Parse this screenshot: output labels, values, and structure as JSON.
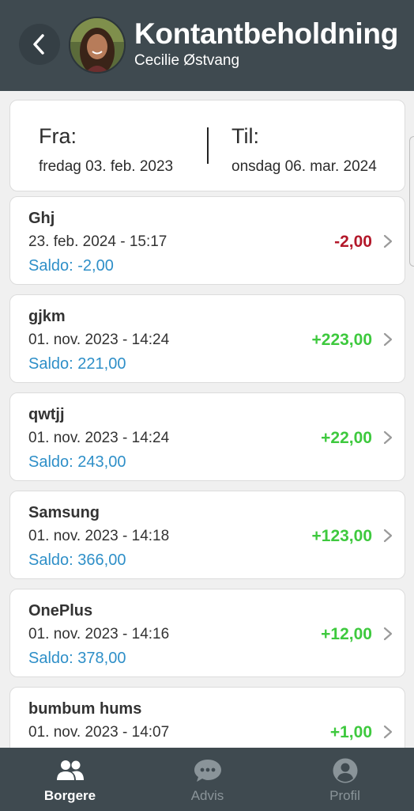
{
  "header": {
    "title": "Kontantbeholdning",
    "subtitle": "Cecilie Østvang",
    "back_icon": "chevron-left-icon",
    "avatar": "profile-photo"
  },
  "date_range": {
    "from_label": "Fra:",
    "from_value": "fredag 03. feb. 2023",
    "to_label": "Til:",
    "to_value": "onsdag 06. mar. 2024"
  },
  "transactions": [
    {
      "name": "Ghj",
      "date": "23. feb. 2024 - 15:17",
      "saldo": "Saldo: -2,00",
      "amount": "-2,00",
      "sign": "negative"
    },
    {
      "name": "gjkm",
      "date": "01. nov. 2023 - 14:24",
      "saldo": "Saldo: 221,00",
      "amount": "+223,00",
      "sign": "positive"
    },
    {
      "name": "qwtjj",
      "date": "01. nov. 2023 - 14:24",
      "saldo": "Saldo: 243,00",
      "amount": "+22,00",
      "sign": "positive"
    },
    {
      "name": "Samsung",
      "date": "01. nov. 2023 - 14:18",
      "saldo": "Saldo: 366,00",
      "amount": "+123,00",
      "sign": "positive"
    },
    {
      "name": "OnePlus",
      "date": "01. nov. 2023 - 14:16",
      "saldo": "Saldo: 378,00",
      "amount": "+12,00",
      "sign": "positive"
    },
    {
      "name": "bumbum hums",
      "date": "01. nov. 2023 - 14:07",
      "saldo": "",
      "amount": "+1,00",
      "sign": "positive"
    }
  ],
  "tabs": [
    {
      "label": "Borgere",
      "icon": "people-icon",
      "active": true
    },
    {
      "label": "Advis",
      "icon": "chat-bubble-icon",
      "active": false
    },
    {
      "label": "Profil",
      "icon": "user-circle-icon",
      "active": false
    }
  ],
  "colors": {
    "header_bg": "#3f4a50",
    "positive": "#3ec93e",
    "negative": "#b3182a",
    "saldo": "#2e8fc8"
  }
}
